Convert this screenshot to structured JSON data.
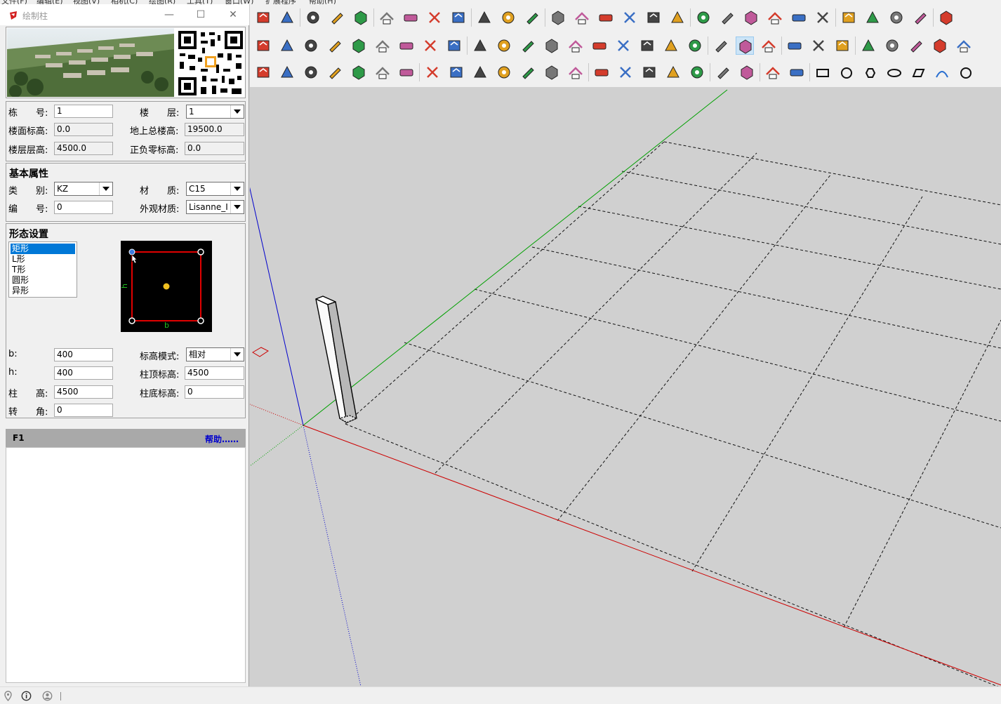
{
  "menu": [
    "文件(F)",
    "编辑(E)",
    "视图(V)",
    "相机(C)",
    "绘图(R)",
    "工具(T)",
    "窗口(W)",
    "扩展程序",
    "帮助(H)"
  ],
  "panel": {
    "title": "绘制柱",
    "window_controls": {
      "minimize": "—",
      "maximize": "☐",
      "close": "✕"
    },
    "floor_fields": {
      "building_no_label": "栋　　号:",
      "building_no": "1",
      "floor_label": "楼　　层:",
      "floor": "1",
      "floor_elev_label": "楼面标高:",
      "floor_elev": "0.0",
      "total_height_label": "地上总楼高:",
      "total_height": "19500.0",
      "story_height_label": "楼层层高:",
      "story_height": "4500.0",
      "zero_elev_label": "正负零标高:",
      "zero_elev": "0.0"
    },
    "basic": {
      "section_title": "基本属性",
      "category_label": "类　　别:",
      "category": "KZ",
      "material_label": "材　　质:",
      "material": "C15",
      "code_label": "编　　号:",
      "code": "0",
      "appearance_label": "外观材质:",
      "appearance": "Lisanne_I"
    },
    "shape": {
      "section_title": "形态设置",
      "options": [
        "矩形",
        "L形",
        "T形",
        "圆形",
        "异形"
      ],
      "selected": "矩形",
      "preview_h": "h",
      "preview_b": "b"
    },
    "dims": {
      "b_label": "b:",
      "b": "400",
      "h_label": "h:",
      "h": "400",
      "height_label": "柱　　高:",
      "height": "4500",
      "angle_label": "转　　角:",
      "angle": "0",
      "elev_mode_label": "标高模式:",
      "elev_mode": "相对",
      "top_elev_label": "柱顶标高:",
      "top_elev": "4500",
      "bottom_elev_label": "柱底标高:",
      "bottom_elev": "0"
    },
    "help": {
      "key": "F1",
      "link": "帮助……"
    }
  },
  "toolbar_icons": {
    "row1": [
      "reload-icon",
      "export-icon",
      "tape-measure-icon",
      "text-icon",
      "paint-bucket-icon",
      "orbit-icon",
      "pan-icon",
      "zoom-icon",
      "zoom-extents-icon",
      "warehouse-icon",
      "extension-warehouse-icon",
      "layout-icon",
      "iso-view-icon",
      "top-view-icon",
      "front-view-icon",
      "right-view-icon",
      "back-view-icon",
      "left-view-icon",
      "component-a-icon",
      "component-b-icon",
      "component-c-icon",
      "component-d-icon",
      "component-e-icon",
      "component-f-icon",
      "texture-icon",
      "grid-icon",
      "section-plane-icon",
      "section-cut-icon",
      "bag-icon"
    ],
    "row2": [
      "wall-icon",
      "arc-wall-icon",
      "check-line-icon",
      "roof-icon",
      "slab-icon",
      "stair-icon",
      "path-icon",
      "polyline-icon",
      "eraser-icon",
      "box-icon",
      "stripes-icon",
      "lift-icon",
      "arch-icon",
      "stack-icon",
      "layers-icon",
      "window-icon",
      "plans-icon",
      "pencil-point-icon",
      "brush-icon",
      "ib-icon",
      "sketchup-logo-icon",
      "su-app-icon",
      "shell-icon",
      "magnet-icon",
      "gem-icon",
      "push-up-icon",
      "push-multi-icon",
      "push-j-icon",
      "push-r-icon",
      "push-v-icon"
    ],
    "row3": [
      "trim-icon",
      "beam-icon",
      "pipe-icon",
      "stack-plate-icon",
      "stack-plate-2-icon",
      "wardrobe-icon",
      "hat-icon",
      "dome-icon",
      "chain-icon",
      "wave-icon",
      "spiral-icon",
      "fence-icon",
      "grille-icon",
      "column-set-icon",
      "triangle-icon",
      "dots-icon",
      "door-icon",
      "figure-icon",
      "sweep-brush-icon",
      "model-icon",
      "camera-badge-icon",
      "leaf-icon",
      "ruler-pencil-icon",
      "rect-shape-icon",
      "circle-shape-icon",
      "hexagon-shape-icon",
      "ellipse-shape-icon",
      "parallelogram-shape-icon",
      "arc-shape-icon",
      "ring-shape-icon"
    ]
  },
  "status": {
    "icons": [
      "geo-location-icon",
      "info-icon",
      "user-icon"
    ]
  },
  "colors": {
    "red_axis": "#cc0000",
    "green_axis": "#00a000",
    "blue_axis": "#0000cc",
    "panel_bg": "#f0f0f0",
    "viewport_bg": "#d0d0d0",
    "selection": "#0078d7"
  }
}
